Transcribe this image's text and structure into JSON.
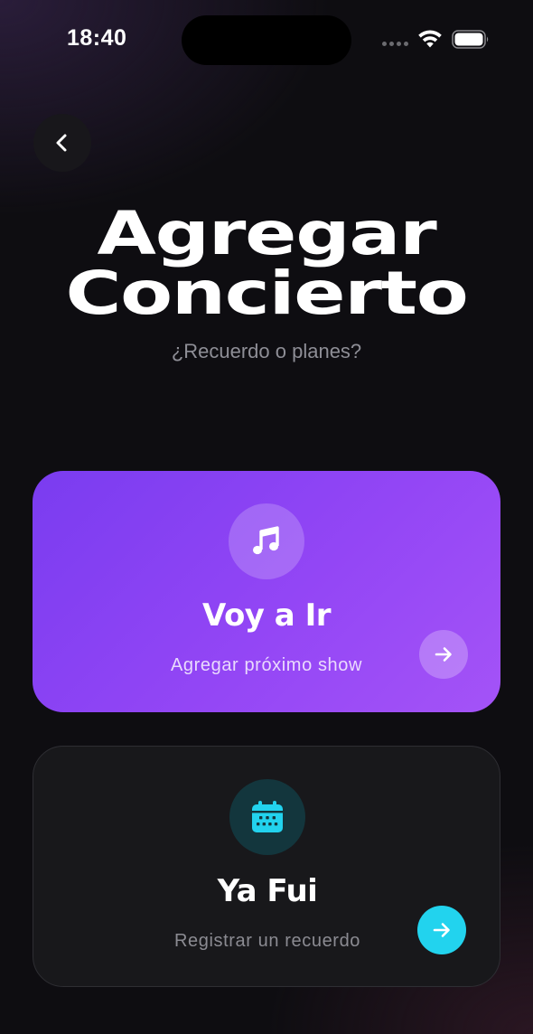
{
  "status_bar": {
    "time": "18:40",
    "icons": [
      "signal-icon",
      "wifi-icon",
      "battery-icon"
    ]
  },
  "header": {
    "back_icon": "chevron-left-icon",
    "title_line1": "Agregar",
    "title_line2": "Concierto",
    "subtitle": "¿Recuerdo o planes?"
  },
  "options": [
    {
      "icon": "music-note-icon",
      "title": "Voy a Ir",
      "description": "Agregar próximo show",
      "arrow_icon": "arrow-right-icon",
      "accent": "#8b45f5"
    },
    {
      "icon": "calendar-icon",
      "title": "Ya Fui",
      "description": "Registrar un recuerdo",
      "arrow_icon": "arrow-right-icon",
      "accent": "#22d3ee"
    }
  ],
  "colors": {
    "background": "#0e0d11",
    "purple_card": "#8b45f5",
    "dark_card": "#18181b",
    "cyan_accent": "#22d3ee"
  }
}
